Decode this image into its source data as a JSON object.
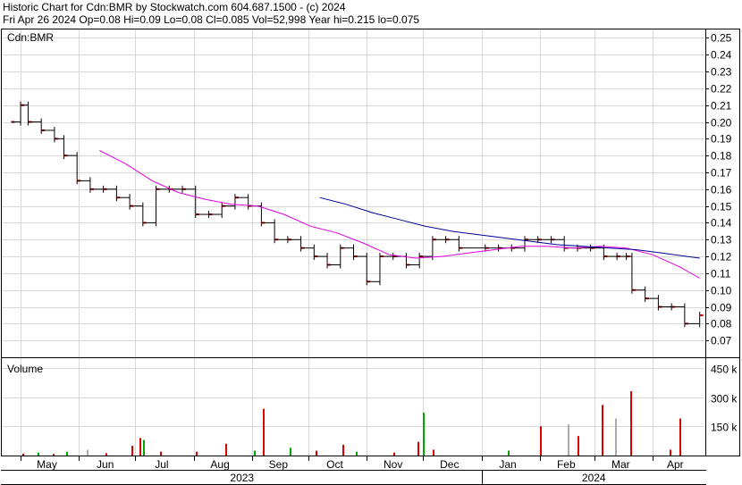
{
  "header": {
    "line1": "Historic Chart for Cdn:BMR by Stockwatch.com 604.687.1500 - (c) 2024",
    "line2": "Fri Apr 26 2024  Op=0.08  Hi=0.09  Lo=0.08  Cl=0.085  Vol=52,998  Year hi=0.215  lo=0.075"
  },
  "chart_data": [
    {
      "type": "line",
      "title": "Cdn:BMR",
      "ylim": [
        0.06,
        0.255
      ],
      "yticks": [
        "0.25",
        "0.24",
        "0.23",
        "0.22",
        "0.21",
        "0.20",
        "0.19",
        "0.18",
        "0.17",
        "0.16",
        "0.15",
        "0.14",
        "0.13",
        "0.12",
        "0.11",
        "0.10",
        "0.09",
        "0.08",
        "0.07"
      ],
      "grid": true,
      "colors": {
        "price": "#000000",
        "ticks": "#cc0000",
        "ma_short": "#e000e0",
        "ma_long": "#000099"
      },
      "price_series": [
        {
          "x": "2023-04-26",
          "y": 0.2
        },
        {
          "x": "2023-05-01",
          "y": 0.21
        },
        {
          "x": "2023-05-05",
          "y": 0.2
        },
        {
          "x": "2023-05-12",
          "y": 0.195
        },
        {
          "x": "2023-05-19",
          "y": 0.19
        },
        {
          "x": "2023-05-24",
          "y": 0.18
        },
        {
          "x": "2023-05-31",
          "y": 0.165
        },
        {
          "x": "2023-06-07",
          "y": 0.16
        },
        {
          "x": "2023-06-14",
          "y": 0.16
        },
        {
          "x": "2023-06-21",
          "y": 0.155
        },
        {
          "x": "2023-06-28",
          "y": 0.15
        },
        {
          "x": "2023-07-05",
          "y": 0.14
        },
        {
          "x": "2023-07-12",
          "y": 0.16
        },
        {
          "x": "2023-07-19",
          "y": 0.16
        },
        {
          "x": "2023-07-26",
          "y": 0.16
        },
        {
          "x": "2023-08-02",
          "y": 0.145
        },
        {
          "x": "2023-08-09",
          "y": 0.145
        },
        {
          "x": "2023-08-16",
          "y": 0.15
        },
        {
          "x": "2023-08-23",
          "y": 0.155
        },
        {
          "x": "2023-08-30",
          "y": 0.15
        },
        {
          "x": "2023-09-06",
          "y": 0.14
        },
        {
          "x": "2023-09-13",
          "y": 0.13
        },
        {
          "x": "2023-09-20",
          "y": 0.13
        },
        {
          "x": "2023-09-27",
          "y": 0.125
        },
        {
          "x": "2023-10-04",
          "y": 0.12
        },
        {
          "x": "2023-10-11",
          "y": 0.115
        },
        {
          "x": "2023-10-18",
          "y": 0.125
        },
        {
          "x": "2023-10-25",
          "y": 0.12
        },
        {
          "x": "2023-11-01",
          "y": 0.105
        },
        {
          "x": "2023-11-08",
          "y": 0.12
        },
        {
          "x": "2023-11-15",
          "y": 0.12
        },
        {
          "x": "2023-11-22",
          "y": 0.115
        },
        {
          "x": "2023-11-29",
          "y": 0.12
        },
        {
          "x": "2023-12-06",
          "y": 0.13
        },
        {
          "x": "2023-12-13",
          "y": 0.13
        },
        {
          "x": "2023-12-20",
          "y": 0.125
        },
        {
          "x": "2024-01-03",
          "y": 0.125
        },
        {
          "x": "2024-01-10",
          "y": 0.125
        },
        {
          "x": "2024-01-17",
          "y": 0.125
        },
        {
          "x": "2024-01-24",
          "y": 0.13
        },
        {
          "x": "2024-01-31",
          "y": 0.13
        },
        {
          "x": "2024-02-07",
          "y": 0.13
        },
        {
          "x": "2024-02-14",
          "y": 0.125
        },
        {
          "x": "2024-02-21",
          "y": 0.125
        },
        {
          "x": "2024-02-28",
          "y": 0.125
        },
        {
          "x": "2024-03-06",
          "y": 0.12
        },
        {
          "x": "2024-03-13",
          "y": 0.12
        },
        {
          "x": "2024-03-18",
          "y": 0.12
        },
        {
          "x": "2024-03-21",
          "y": 0.1
        },
        {
          "x": "2024-03-28",
          "y": 0.095
        },
        {
          "x": "2024-04-04",
          "y": 0.09
        },
        {
          "x": "2024-04-11",
          "y": 0.09
        },
        {
          "x": "2024-04-18",
          "y": 0.08
        },
        {
          "x": "2024-04-26",
          "y": 0.085
        }
      ],
      "ma_short": [
        {
          "x": "2023-06-12",
          "y": 0.183
        },
        {
          "x": "2023-06-26",
          "y": 0.175
        },
        {
          "x": "2023-07-10",
          "y": 0.165
        },
        {
          "x": "2023-07-24",
          "y": 0.158
        },
        {
          "x": "2023-08-07",
          "y": 0.154
        },
        {
          "x": "2023-08-21",
          "y": 0.151
        },
        {
          "x": "2023-09-04",
          "y": 0.15
        },
        {
          "x": "2023-09-18",
          "y": 0.145
        },
        {
          "x": "2023-10-02",
          "y": 0.138
        },
        {
          "x": "2023-10-16",
          "y": 0.134
        },
        {
          "x": "2023-10-30",
          "y": 0.128
        },
        {
          "x": "2023-11-13",
          "y": 0.121
        },
        {
          "x": "2023-11-27",
          "y": 0.119
        },
        {
          "x": "2023-12-11",
          "y": 0.12
        },
        {
          "x": "2023-12-25",
          "y": 0.122
        },
        {
          "x": "2024-01-08",
          "y": 0.124
        },
        {
          "x": "2024-01-22",
          "y": 0.126
        },
        {
          "x": "2024-02-05",
          "y": 0.126
        },
        {
          "x": "2024-02-19",
          "y": 0.125
        },
        {
          "x": "2024-03-04",
          "y": 0.126
        },
        {
          "x": "2024-03-18",
          "y": 0.125
        },
        {
          "x": "2024-04-01",
          "y": 0.121
        },
        {
          "x": "2024-04-15",
          "y": 0.114
        },
        {
          "x": "2024-04-26",
          "y": 0.107
        }
      ],
      "ma_long": [
        {
          "x": "2023-10-07",
          "y": 0.155
        },
        {
          "x": "2023-10-21",
          "y": 0.151
        },
        {
          "x": "2023-11-04",
          "y": 0.146
        },
        {
          "x": "2023-11-18",
          "y": 0.142
        },
        {
          "x": "2023-12-02",
          "y": 0.138
        },
        {
          "x": "2023-12-16",
          "y": 0.135
        },
        {
          "x": "2023-12-30",
          "y": 0.133
        },
        {
          "x": "2024-01-13",
          "y": 0.131
        },
        {
          "x": "2024-01-27",
          "y": 0.129
        },
        {
          "x": "2024-02-10",
          "y": 0.127
        },
        {
          "x": "2024-02-24",
          "y": 0.126
        },
        {
          "x": "2024-03-09",
          "y": 0.125
        },
        {
          "x": "2024-03-23",
          "y": 0.124
        },
        {
          "x": "2024-04-06",
          "y": 0.122
        },
        {
          "x": "2024-04-26",
          "y": 0.119
        }
      ]
    },
    {
      "type": "bar",
      "title": "Volume",
      "ylim": [
        0,
        500
      ],
      "yticks": [
        "450 k",
        "300 k",
        "150 k"
      ],
      "colors": {
        "up": "#00aa00",
        "down": "#dd0000",
        "flat": "#aaaaaa"
      },
      "bars": [
        {
          "x": "2023-05-02",
          "v": 10,
          "c": "down"
        },
        {
          "x": "2023-05-10",
          "v": 15,
          "c": "up"
        },
        {
          "x": "2023-05-18",
          "v": 8,
          "c": "down"
        },
        {
          "x": "2023-05-25",
          "v": 20,
          "c": "up"
        },
        {
          "x": "2023-06-05",
          "v": 30,
          "c": "flat"
        },
        {
          "x": "2023-06-15",
          "v": 12,
          "c": "down"
        },
        {
          "x": "2023-06-29",
          "v": 50,
          "c": "down"
        },
        {
          "x": "2023-07-03",
          "v": 90,
          "c": "down"
        },
        {
          "x": "2023-07-05",
          "v": 80,
          "c": "up"
        },
        {
          "x": "2023-07-14",
          "v": 20,
          "c": "down"
        },
        {
          "x": "2023-08-02",
          "v": 20,
          "c": "down"
        },
        {
          "x": "2023-08-18",
          "v": 60,
          "c": "down"
        },
        {
          "x": "2023-09-02",
          "v": 25,
          "c": "up"
        },
        {
          "x": "2023-09-07",
          "v": 240,
          "c": "down"
        },
        {
          "x": "2023-09-21",
          "v": 40,
          "c": "up"
        },
        {
          "x": "2023-10-05",
          "v": 25,
          "c": "down"
        },
        {
          "x": "2023-10-19",
          "v": 55,
          "c": "down"
        },
        {
          "x": "2023-10-26",
          "v": 20,
          "c": "up"
        },
        {
          "x": "2023-11-15",
          "v": 15,
          "c": "down"
        },
        {
          "x": "2023-11-28",
          "v": 70,
          "c": "down"
        },
        {
          "x": "2023-12-01",
          "v": 220,
          "c": "up"
        },
        {
          "x": "2023-12-06",
          "v": 30,
          "c": "down"
        },
        {
          "x": "2024-01-15",
          "v": 25,
          "c": "up"
        },
        {
          "x": "2024-02-01",
          "v": 150,
          "c": "down"
        },
        {
          "x": "2024-02-16",
          "v": 160,
          "c": "flat"
        },
        {
          "x": "2024-02-21",
          "v": 100,
          "c": "down"
        },
        {
          "x": "2024-03-05",
          "v": 260,
          "c": "down"
        },
        {
          "x": "2024-03-12",
          "v": 190,
          "c": "flat"
        },
        {
          "x": "2024-03-20",
          "v": 330,
          "c": "down"
        },
        {
          "x": "2024-04-10",
          "v": 30,
          "c": "down"
        },
        {
          "x": "2024-04-15",
          "v": 190,
          "c": "down"
        }
      ]
    }
  ],
  "xaxis": {
    "months": [
      "May",
      "Jun",
      "Jul",
      "Aug",
      "Sep",
      "Oct",
      "Nov",
      "Dec",
      "Jan",
      "Feb",
      "Mar",
      "Apr"
    ],
    "years": [
      "2023",
      "2024"
    ]
  }
}
